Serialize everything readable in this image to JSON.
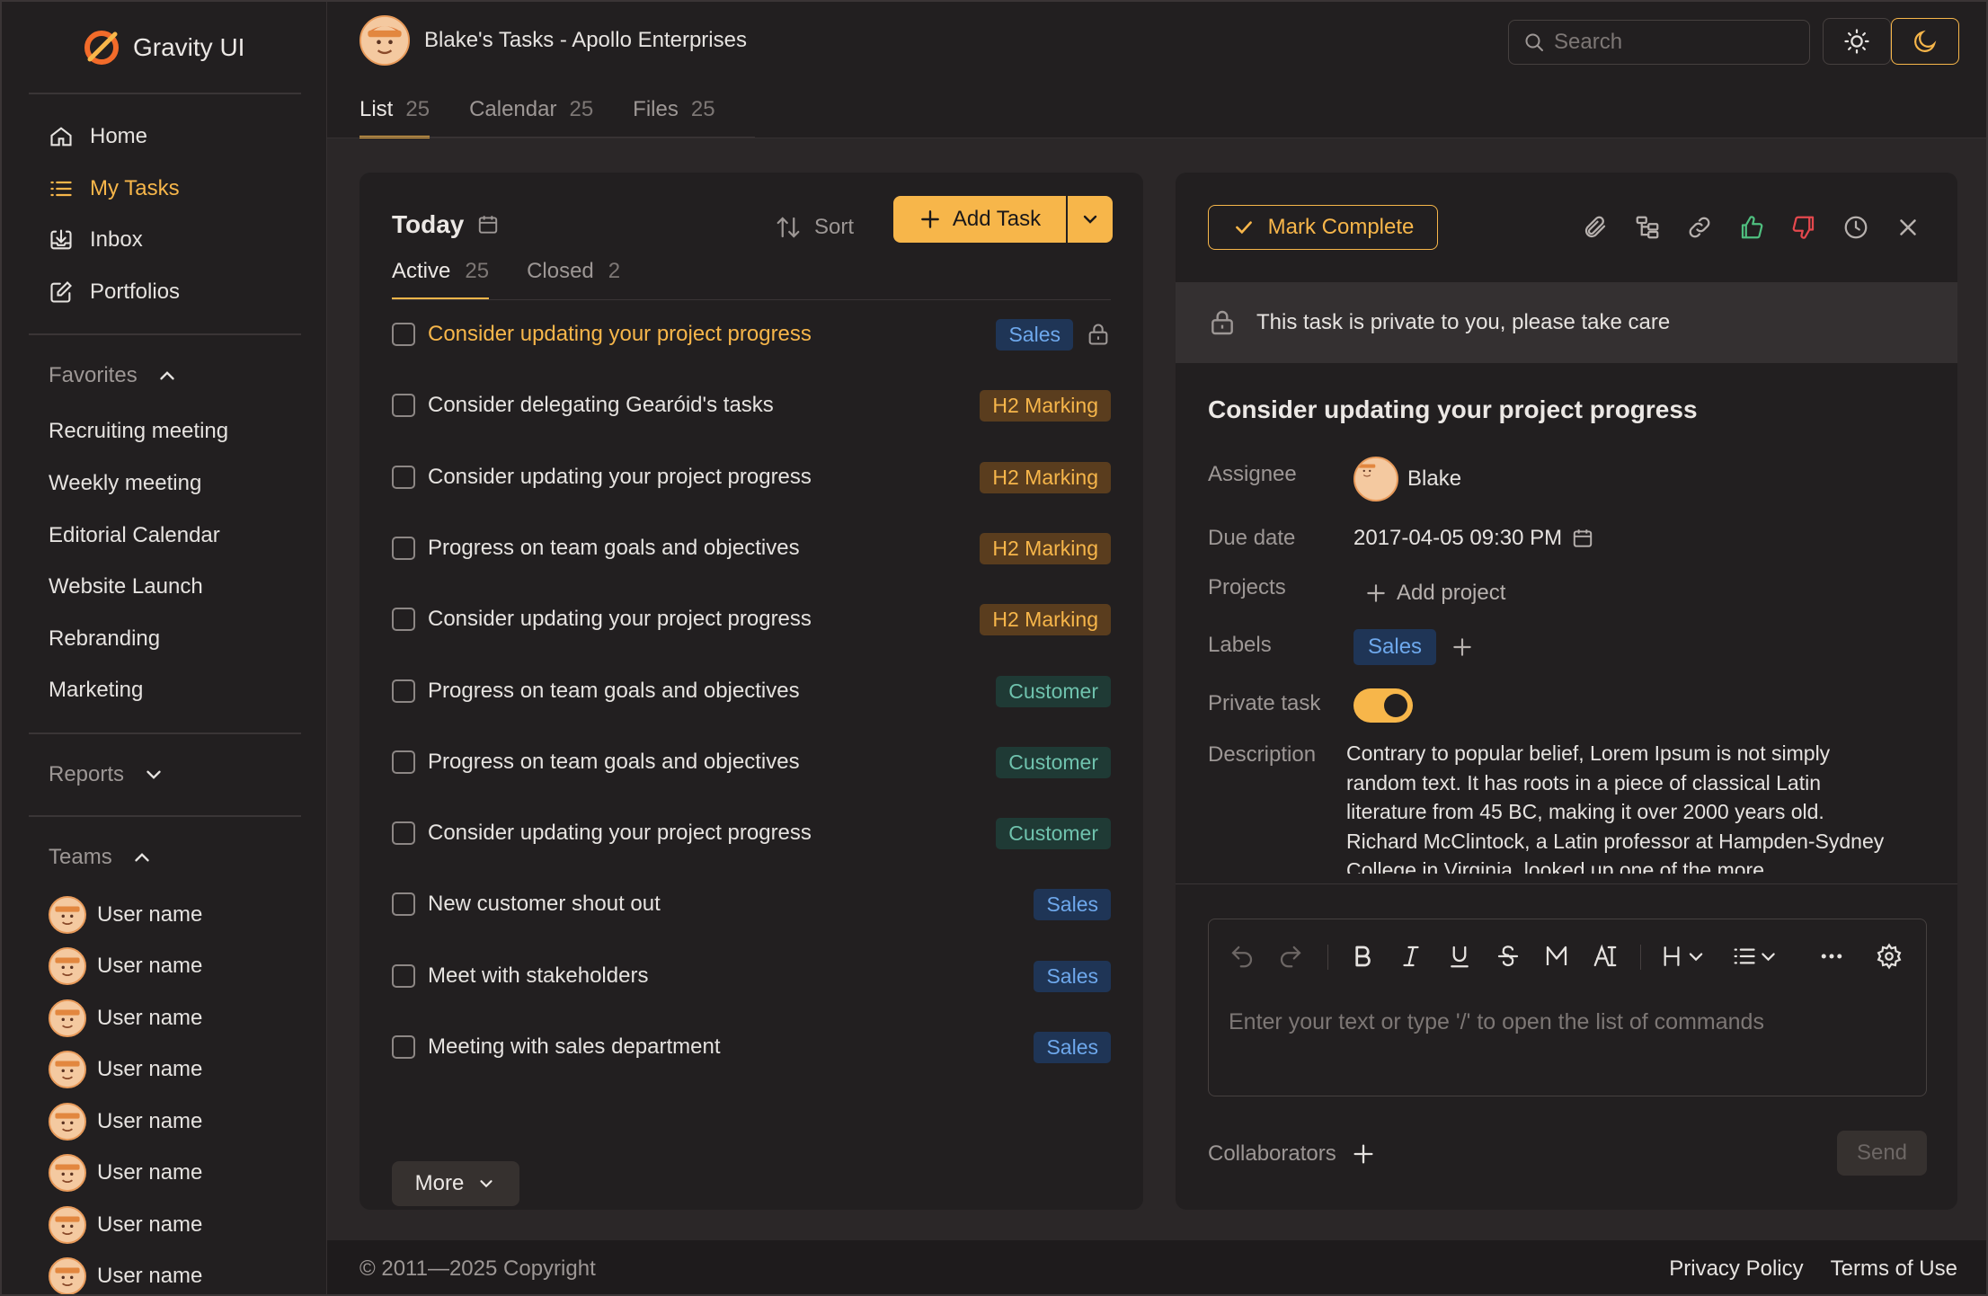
{
  "brand": {
    "name": "Gravity UI"
  },
  "nav": [
    {
      "label": "Home",
      "icon": "home-icon"
    },
    {
      "label": "My Tasks",
      "icon": "list-icon",
      "active": true
    },
    {
      "label": "Inbox",
      "icon": "inbox-icon"
    },
    {
      "label": "Portfolios",
      "icon": "edit-icon"
    }
  ],
  "favorites": {
    "label": "Favorites",
    "items": [
      "Recruiting meeting",
      "Weekly meeting",
      "Editorial Calendar",
      "Website Launch",
      "Rebranding",
      "Marketing"
    ]
  },
  "reports": {
    "label": "Reports"
  },
  "teams": {
    "label": "Teams",
    "items": [
      "User name",
      "User name",
      "User name",
      "User name",
      "User name",
      "User name",
      "User name",
      "User name"
    ]
  },
  "header": {
    "title": "Blake's Tasks - Apollo Enterprises",
    "tabs": [
      {
        "label": "List",
        "count": "25",
        "active": true
      },
      {
        "label": "Calendar",
        "count": "25"
      },
      {
        "label": "Files",
        "count": "25"
      }
    ],
    "search_placeholder": "Search"
  },
  "task_list": {
    "heading": "Today",
    "sort_label": "Sort",
    "add_label": "Add Task",
    "subtabs": [
      {
        "label": "Active",
        "count": "25",
        "active": true
      },
      {
        "label": "Closed",
        "count": "2"
      }
    ],
    "tasks": [
      {
        "title": "Consider updating your project progress",
        "tag": "Sales",
        "tag_type": "sales",
        "highlight": true,
        "locked": true
      },
      {
        "title": "Consider delegating Gearóid's tasks",
        "tag": "H2 Marking",
        "tag_type": "h2"
      },
      {
        "title": "Consider updating your project progress",
        "tag": "H2 Marking",
        "tag_type": "h2"
      },
      {
        "title": "Progress on team goals and objectives",
        "tag": "H2 Marking",
        "tag_type": "h2"
      },
      {
        "title": "Consider updating your project progress",
        "tag": "H2 Marking",
        "tag_type": "h2"
      },
      {
        "title": "Progress on team goals and objectives",
        "tag": "Customer",
        "tag_type": "customer"
      },
      {
        "title": "Progress on team goals and objectives",
        "tag": "Customer",
        "tag_type": "customer"
      },
      {
        "title": "Consider updating your project progress",
        "tag": "Customer",
        "tag_type": "customer"
      },
      {
        "title": "New customer shout out",
        "tag": "Sales",
        "tag_type": "sales"
      },
      {
        "title": "Meet with stakeholders",
        "tag": "Sales",
        "tag_type": "sales"
      },
      {
        "title": "Meeting with sales department",
        "tag": "Sales",
        "tag_type": "sales"
      }
    ],
    "more_label": "More"
  },
  "detail": {
    "mark_complete_label": "Mark Complete",
    "private_banner": "This task is private to you, please take care",
    "title": "Consider updating your project progress",
    "assignee_label": "Assignee",
    "assignee": "Blake",
    "due_label": "Due date",
    "due_value": "2017-04-05 09:30 PM",
    "projects_label": "Projects",
    "add_project_label": "Add project",
    "labels_label": "Labels",
    "label_value": "Sales",
    "private_label": "Private task",
    "private_on": true,
    "description_label": "Description",
    "description": "Contrary to popular belief, Lorem Ipsum is not simply random text. It has roots in a piece of classical Latin literature from 45 BC, making it over 2000 years old. Richard McClintock, a Latin professor at Hampden-Sydney College in Virginia, looked up one of the more",
    "editor_placeholder": "Enter your text or type '/' to open the list of commands",
    "collaborators_label": "Collaborators",
    "send_label": "Send"
  },
  "footer": {
    "copyright": "© 2011—2025 Copyright",
    "privacy": "Privacy Policy",
    "terms": "Terms of Use"
  },
  "colors": {
    "accent": "#f7b64a",
    "background": "#1a1819",
    "sidebar": "#221f20",
    "tag_sales": "#6ea8ec",
    "tag_h2": "#f7b64a",
    "tag_customer": "#6fc2ad",
    "like_green": "#4fbf7f",
    "dislike_red": "#e5484d"
  }
}
